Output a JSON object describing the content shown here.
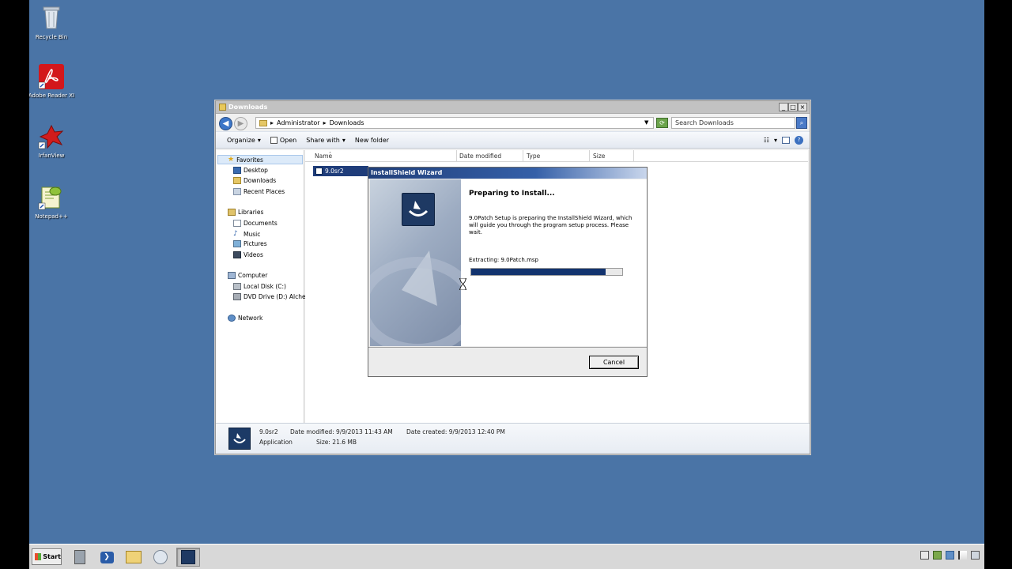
{
  "desktop": {
    "icons": [
      {
        "name": "recycle-bin-icon",
        "label": "Recycle Bin"
      },
      {
        "name": "adobe-reader-icon",
        "label": "Adobe Reader XI"
      },
      {
        "name": "irfanview-icon",
        "label": "IrfanView"
      },
      {
        "name": "notepad-plus-plus-icon",
        "label": "Notepad++"
      }
    ],
    "background_color": "#4a74a6"
  },
  "explorer": {
    "title": "Downloads",
    "window_buttons": {
      "minimize": "_",
      "maximize": "□",
      "close": "×"
    },
    "breadcrumb": [
      "Administrator",
      "Downloads"
    ],
    "search_placeholder": "Search Downloads",
    "toolbar": {
      "organize": "Organize",
      "open": "Open",
      "share_with": "Share with",
      "new_folder": "New folder"
    },
    "nav": {
      "favorites": "Favorites",
      "desktop": "Desktop",
      "downloads": "Downloads",
      "recent_places": "Recent Places",
      "libraries": "Libraries",
      "documents": "Documents",
      "music": "Music",
      "pictures": "Pictures",
      "videos": "Videos",
      "computer": "Computer",
      "local_disk": "Local Disk (C:)",
      "dvd_drive": "DVD Drive (D:) Alchem",
      "network": "Network"
    },
    "columns": {
      "name": "Name",
      "date_modified": "Date modified",
      "type": "Type",
      "size": "Size"
    },
    "files": [
      {
        "name": "9.0sr2"
      }
    ],
    "details": {
      "file_name": "9.0sr2",
      "file_type": "Application",
      "date_modified": "Date modified: 9/9/2013 11:43 AM",
      "size": "Size: 21.6 MB",
      "date_created": "Date created: 9/9/2013 12:40 PM"
    }
  },
  "wizard": {
    "title": "InstallShield Wizard",
    "heading": "Preparing to Install...",
    "description": "9.0Patch Setup is preparing the InstallShield Wizard, which will guide you through the program setup process. Please wait.",
    "status": "Extracting: 9.0Patch.msp",
    "progress": 0.89,
    "cancel_label": "Cancel"
  },
  "taskbar": {
    "start_label": "Start",
    "apps": [
      "server-manager-icon",
      "powershell-icon",
      "explorer-icon",
      "installer-icon",
      "installshield-icon"
    ],
    "tray_icons": [
      "display-icon",
      "network-icon",
      "security-icon",
      "flag-icon",
      "volume-icon"
    ]
  }
}
